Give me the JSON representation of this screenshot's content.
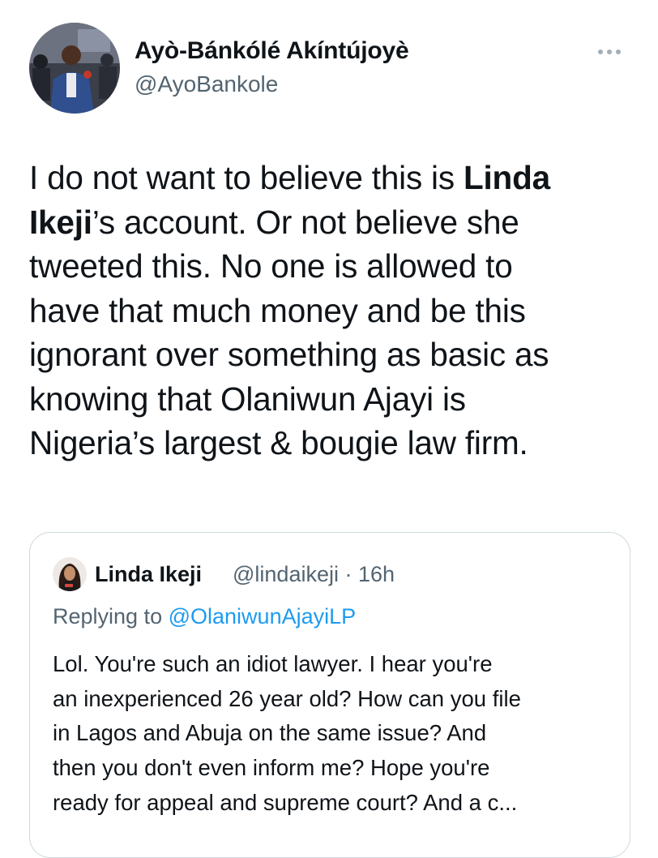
{
  "author": {
    "name": "Ayò-Bánkólé Akíntújoyè",
    "handle": "@AyoBankole"
  },
  "tweet": {
    "lines": [
      [
        "I do not want to believe this is ",
        "Linda"
      ],
      [
        "Ikeji",
        "’s account. Or not believe she"
      ],
      "tweeted this. No one is allowed to",
      "have that much money and be this",
      "ignorant over something as basic as",
      "knowing that Olaniwun Ajayi is",
      "Nigeria’s largest & bougie law firm."
    ]
  },
  "quoted_tweet": {
    "name": "Linda Ikeji",
    "handle_time": "@lindaikeji · 16h",
    "replying_prefix": "Replying to",
    "replying_handle": "@OlaniwunAjayiLP",
    "lines": [
      "Lol. You're such an idiot lawyer. I hear you're",
      "an inexperienced 26 year old? How can you file",
      "in Lagos and Abuja on the same issue? And",
      "then you don't even inform me? Hope you're",
      "ready for appeal and supreme court? And a c..."
    ]
  },
  "colors": {
    "text": "#0f1419",
    "secondary": "#536471",
    "link": "#1d9bf0",
    "border": "#cfd9de"
  },
  "icons": {
    "more": "more-horizontal-icon"
  }
}
